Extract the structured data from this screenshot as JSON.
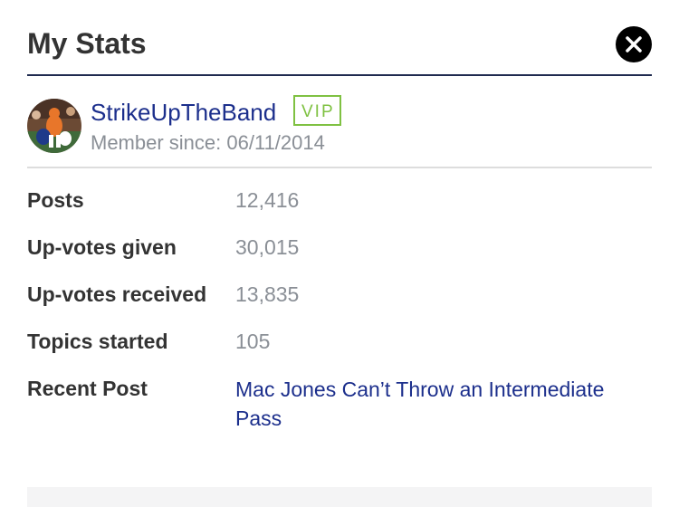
{
  "header": {
    "title": "My Stats",
    "close_icon": "close-icon"
  },
  "profile": {
    "username": "StrikeUpTheBand",
    "badge": "VIP",
    "member_since": "Member since: 06/11/2014",
    "avatar_icon": "avatar-image"
  },
  "stats": [
    {
      "label": "Posts",
      "value": "12,416"
    },
    {
      "label": "Up-votes given",
      "value": "30,015"
    },
    {
      "label": "Up-votes received",
      "value": "13,835"
    },
    {
      "label": "Topics started",
      "value": "105"
    }
  ],
  "recent_post": {
    "label": "Recent Post",
    "title": "Mac Jones Can’t Throw an Intermediate Pass"
  },
  "colors": {
    "link": "#1c2f8c",
    "vip": "#7fc142",
    "muted": "#8a8f96",
    "header_rule": "#1f2a4f"
  }
}
